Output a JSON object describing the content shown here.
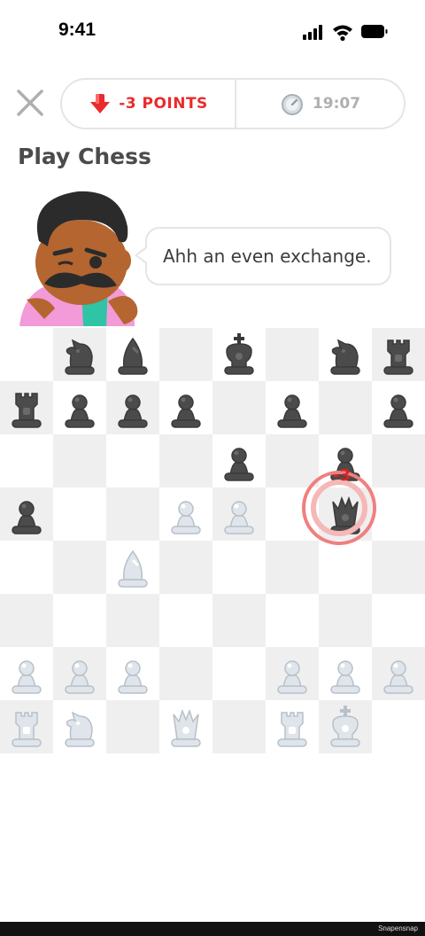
{
  "status_bar": {
    "time": "9:41",
    "signal_icon": "cellular-signal-icon",
    "wifi_icon": "wifi-icon",
    "battery_icon": "battery-icon"
  },
  "header": {
    "close_icon": "close-icon",
    "points_label": "-3 POINTS",
    "points_icon": "down-arrow-icon",
    "timer_label": "19:07",
    "timer_icon": "stopwatch-icon",
    "accent_red": "#ea2b2b",
    "muted_gray": "#afafaf"
  },
  "title": "Play Chess",
  "opponent": {
    "avatar_icon": "character-avatar",
    "message": "Ahh an even exchange."
  },
  "board": {
    "rows": [
      [
        "",
        "black-knight",
        "black-bishop",
        "",
        "black-king",
        "",
        "black-knight",
        "black-rook"
      ],
      [
        "black-rook",
        "black-pawn",
        "black-pawn",
        "black-pawn",
        "",
        "black-pawn",
        "",
        "black-pawn"
      ],
      [
        "",
        "",
        "",
        "",
        "black-pawn",
        "",
        "black-pawn",
        ""
      ],
      [
        "black-pawn",
        "",
        "",
        "white-pawn",
        "white-pawn",
        "",
        "black-queen",
        ""
      ],
      [
        "",
        "",
        "white-bishop",
        "",
        "",
        "",
        "",
        ""
      ],
      [
        "",
        "",
        "",
        "",
        "",
        "",
        "",
        ""
      ],
      [
        "white-pawn",
        "white-pawn",
        "white-pawn",
        "",
        "",
        "white-pawn",
        "white-pawn",
        "white-pawn"
      ],
      [
        "white-rook",
        "white-knight",
        "",
        "white-queen",
        "",
        "white-rook",
        "white-king",
        ""
      ]
    ],
    "highlight": {
      "row": 3,
      "col": 6
    },
    "capture_penalty": "-3"
  },
  "watermark": "Snapensnap"
}
